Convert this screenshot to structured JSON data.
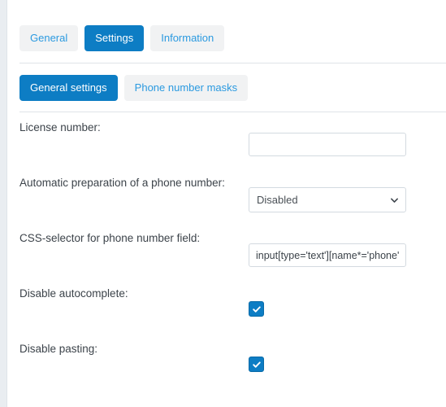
{
  "tabs_primary": [
    {
      "label": "General",
      "active": false
    },
    {
      "label": "Settings",
      "active": true
    },
    {
      "label": "Information",
      "active": false
    }
  ],
  "tabs_secondary": [
    {
      "label": "General settings",
      "active": true
    },
    {
      "label": "Phone number masks",
      "active": false
    }
  ],
  "form": {
    "license": {
      "label": "License number:",
      "value": "",
      "placeholder": ""
    },
    "auto_preparation": {
      "label": "Automatic preparation of a phone number:",
      "value": "Disabled"
    },
    "css_selector": {
      "label": "CSS-selector for phone number field:",
      "value": "input[type='text'][name*='phone']",
      "placeholder": ""
    },
    "disable_autocomplete": {
      "label": "Disable autocomplete:",
      "checked": true
    },
    "disable_pasting": {
      "label": "Disable pasting:",
      "checked": true
    }
  },
  "colors": {
    "accent": "#0d7dc4",
    "tab_inactive_bg": "#f1f2f3",
    "tab_inactive_text": "#2b9ae0",
    "label_text": "#3c434a",
    "border": "#d3dae0",
    "divider": "#dfe3e8"
  }
}
